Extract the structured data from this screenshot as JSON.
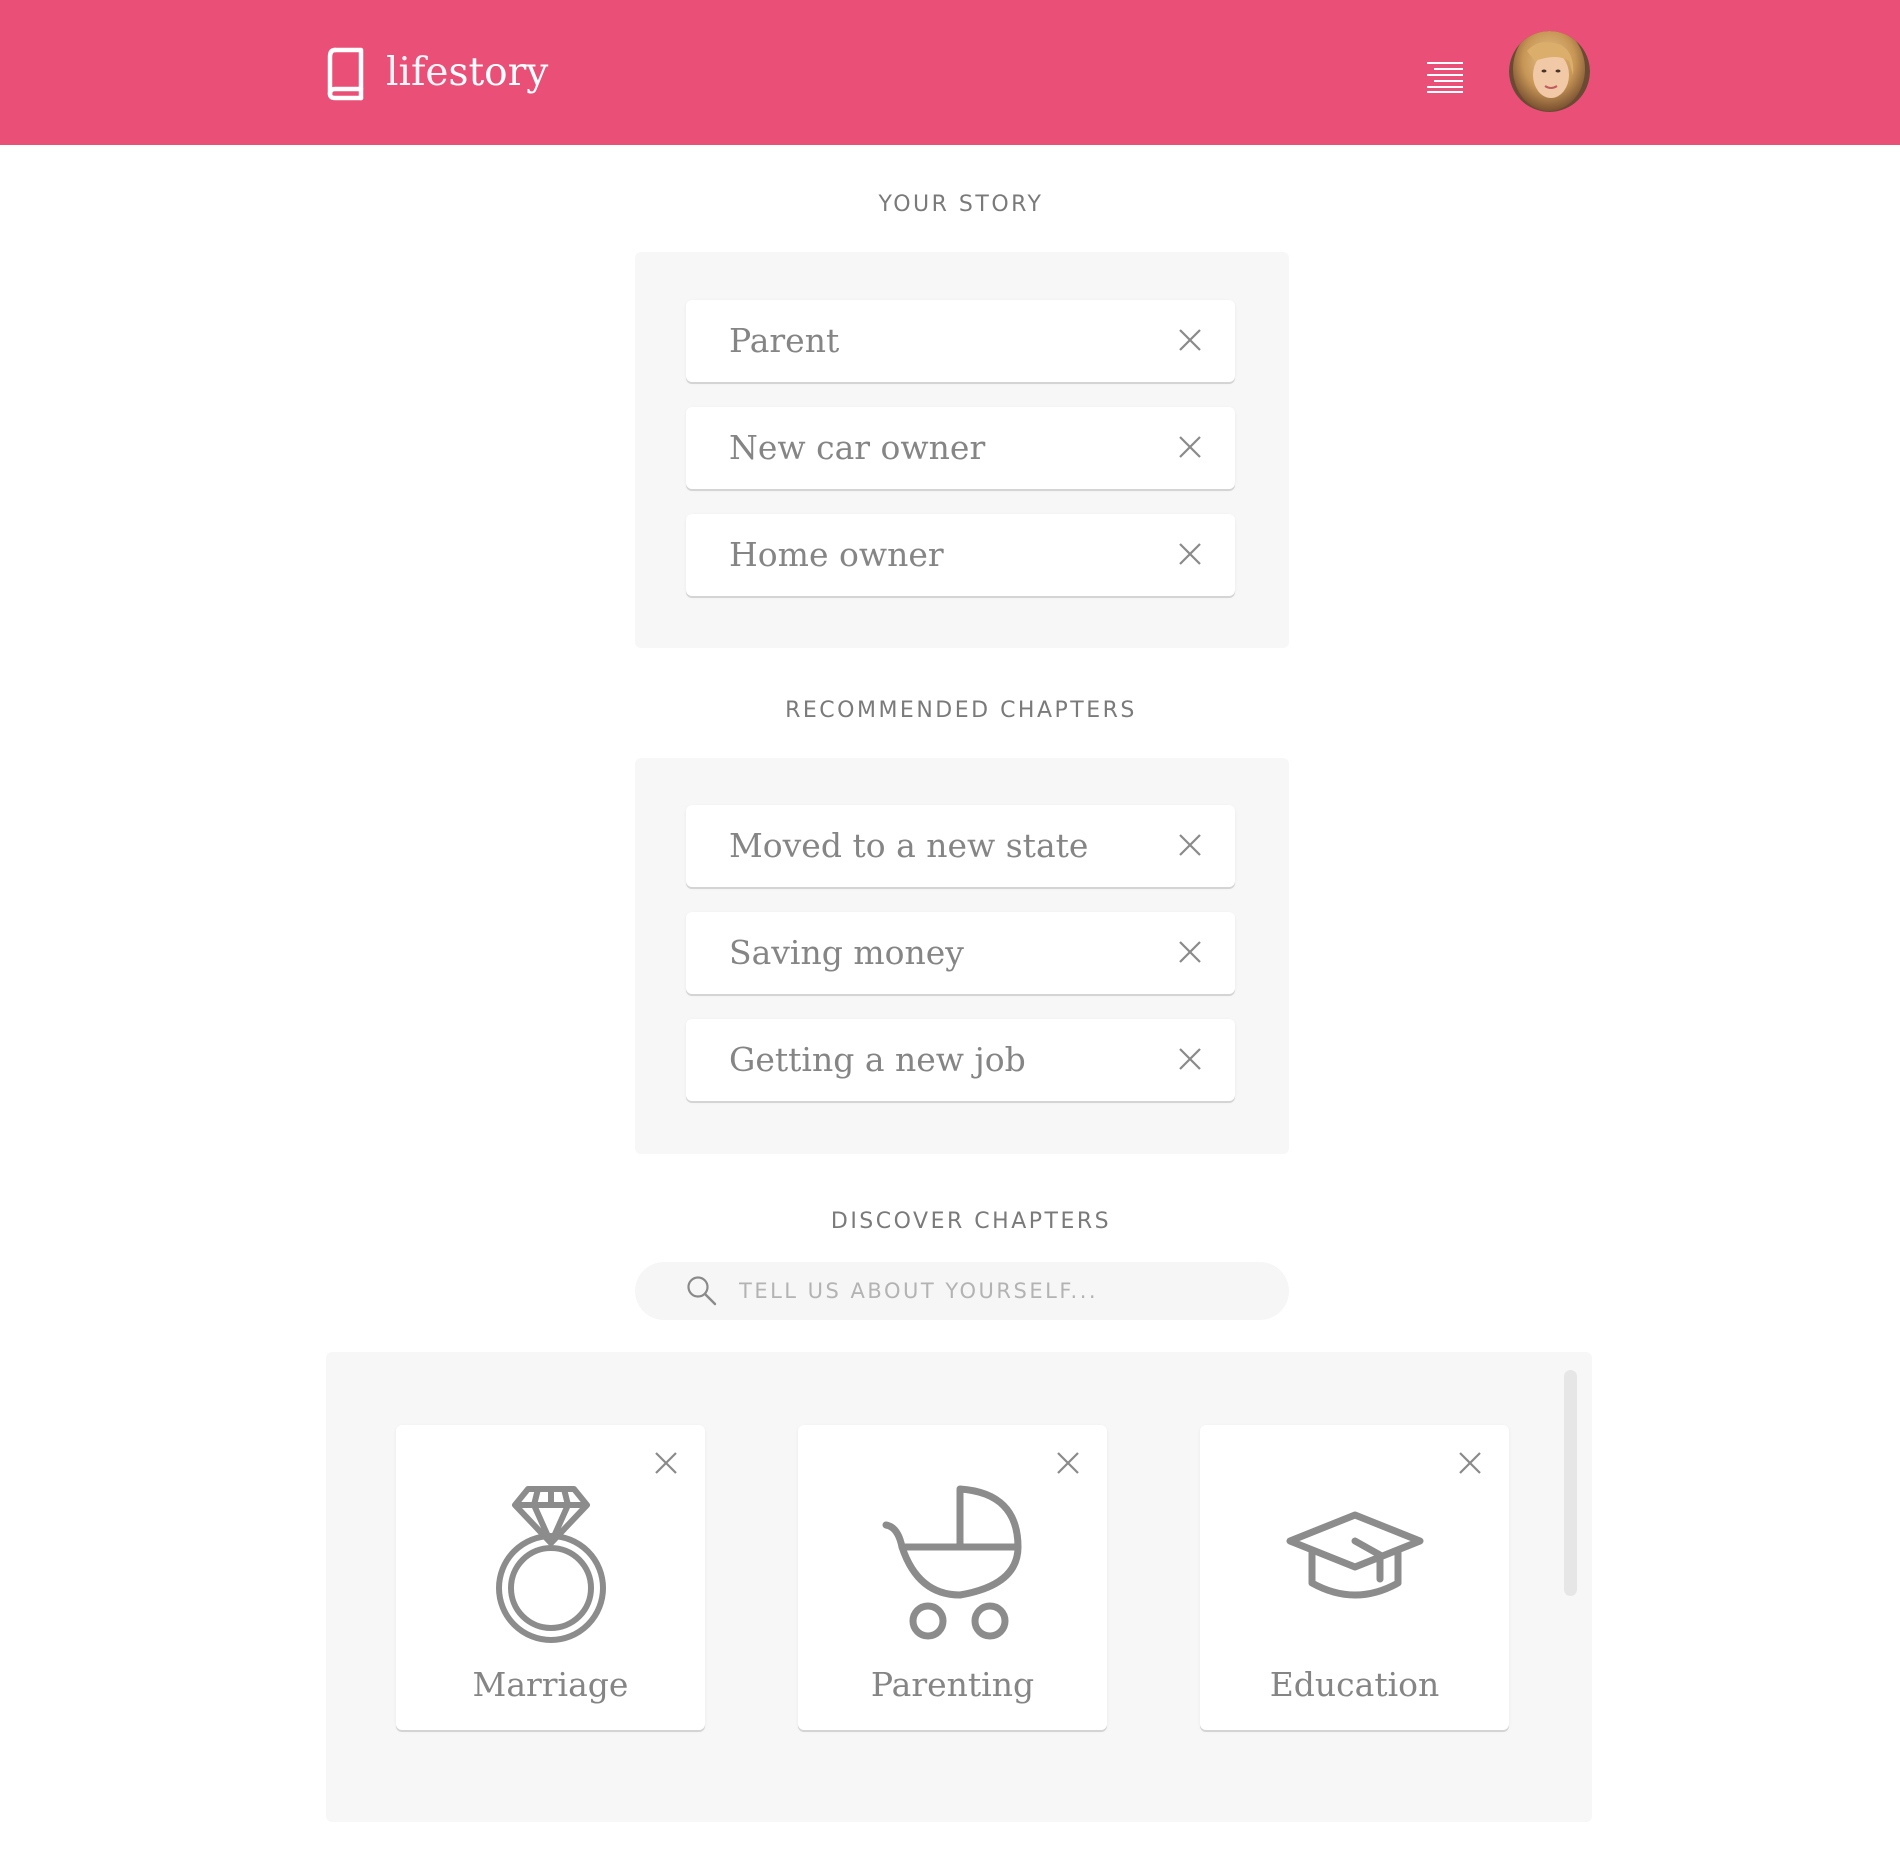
{
  "app": {
    "logo_light": "life",
    "logo_bold": "story"
  },
  "header": {
    "menu_icon": "menu-icon",
    "avatar_icon": "user-avatar"
  },
  "your_story": {
    "heading": "YOUR STORY",
    "items": [
      {
        "label": "Parent"
      },
      {
        "label": "New car owner"
      },
      {
        "label": "Home owner"
      }
    ]
  },
  "recommended": {
    "heading": "RECOMMENDED CHAPTERS",
    "items": [
      {
        "label": "Moved to a new state"
      },
      {
        "label": "Saving money"
      },
      {
        "label": "Getting a new job"
      }
    ]
  },
  "discover": {
    "heading": "DISCOVER CHAPTERS",
    "search_placeholder": "TELL US ABOUT YOURSELF...",
    "search_value": "",
    "cards": [
      {
        "label": "Marriage",
        "icon": "ring-icon"
      },
      {
        "label": "Parenting",
        "icon": "stroller-icon"
      },
      {
        "label": "Education",
        "icon": "graduation-cap-icon"
      }
    ]
  },
  "colors": {
    "brand": "#ea4f77",
    "panel_bg": "#f7f7f7",
    "text": "#858585"
  }
}
